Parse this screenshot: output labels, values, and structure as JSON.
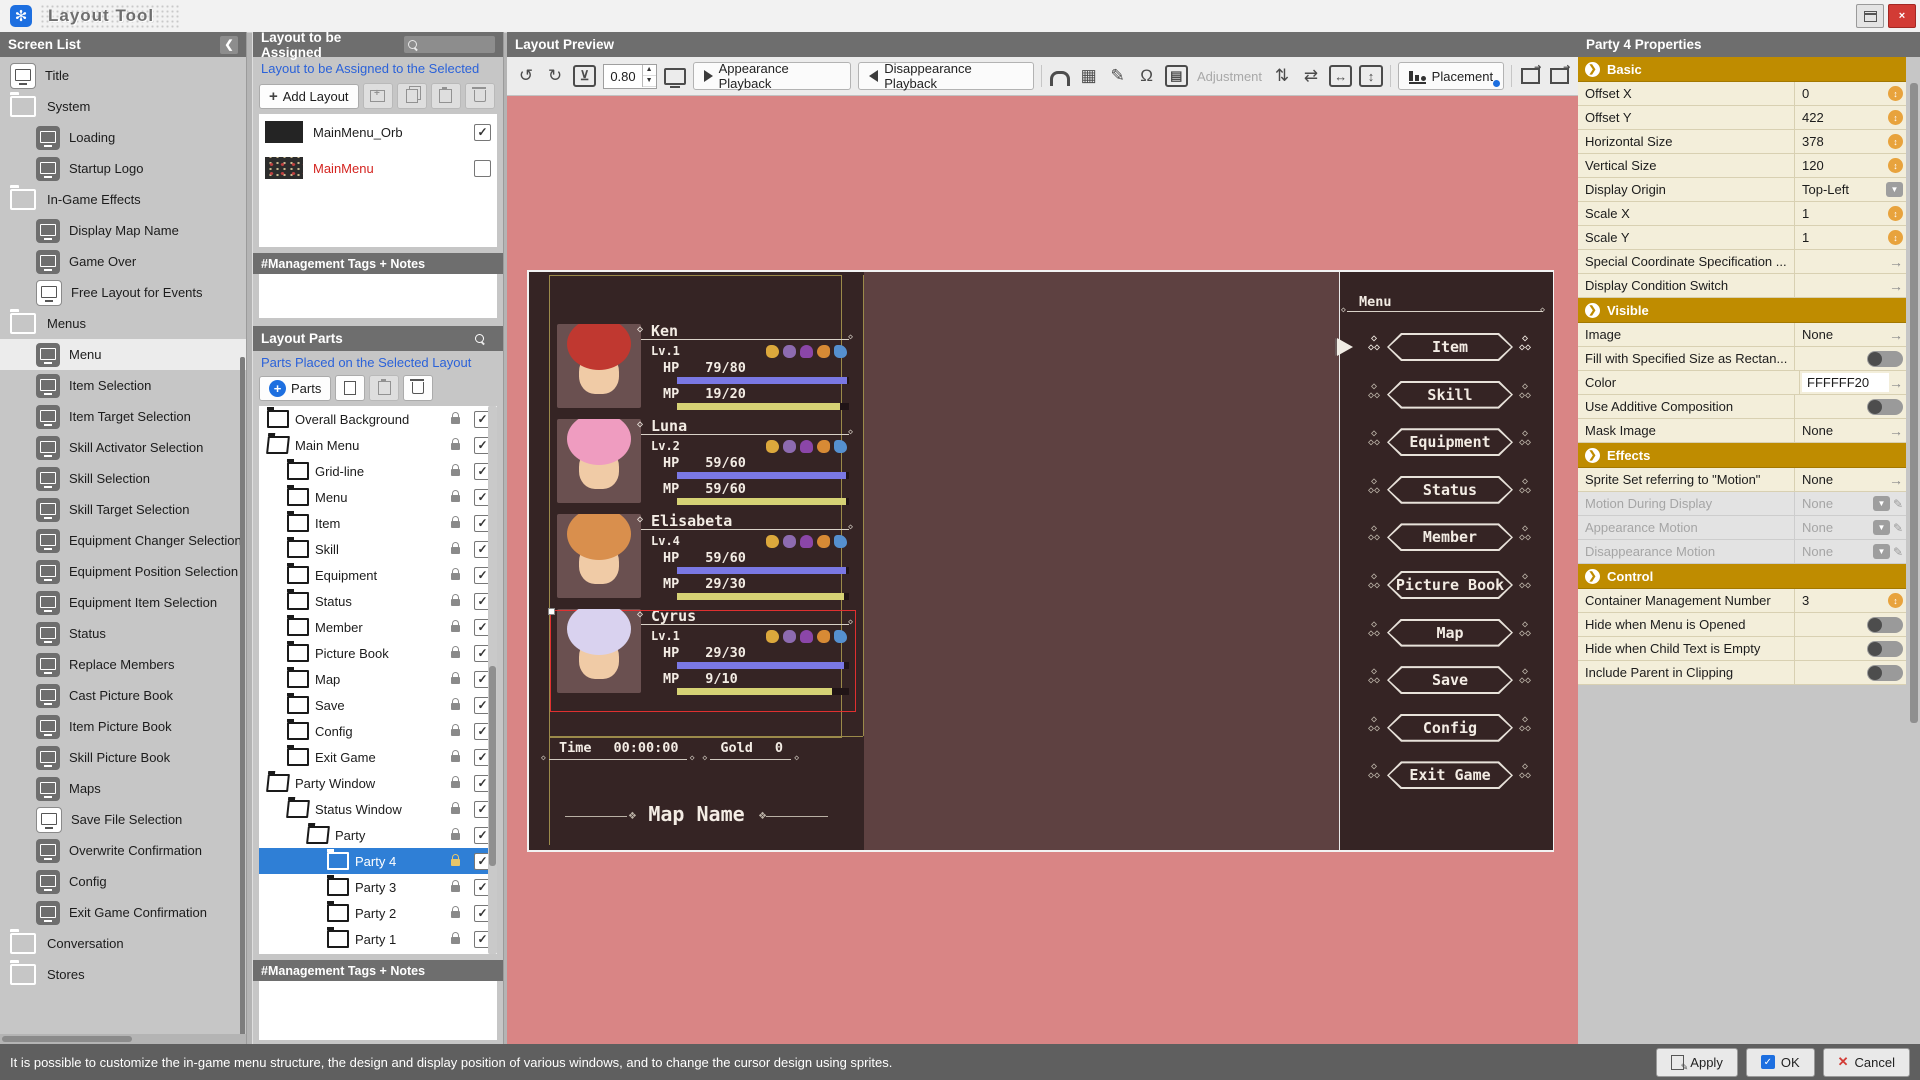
{
  "window": {
    "title": "Layout Tool",
    "close_label": "×"
  },
  "screen_list": {
    "header": "Screen List",
    "collapse_glyph": "❮",
    "items": [
      {
        "label": "Title",
        "kind": "screen",
        "indent": 0,
        "invert": true
      },
      {
        "label": "System",
        "kind": "folder",
        "indent": 0
      },
      {
        "label": "Loading",
        "kind": "screen",
        "indent": 1
      },
      {
        "label": "Startup Logo",
        "kind": "screen",
        "indent": 1
      },
      {
        "label": "In-Game Effects",
        "kind": "folder",
        "indent": 0
      },
      {
        "label": "Display Map Name",
        "kind": "screen",
        "indent": 1
      },
      {
        "label": "Game Over",
        "kind": "screen",
        "indent": 1
      },
      {
        "label": "Free Layout for Events",
        "kind": "screen",
        "indent": 1,
        "invert": true
      },
      {
        "label": "Menus",
        "kind": "folder",
        "indent": 0
      },
      {
        "label": "Menu",
        "kind": "screen",
        "indent": 1,
        "selected": true
      },
      {
        "label": "Item Selection",
        "kind": "screen",
        "indent": 1
      },
      {
        "label": "Item Target Selection",
        "kind": "screen",
        "indent": 1
      },
      {
        "label": "Skill Activator Selection",
        "kind": "screen",
        "indent": 1
      },
      {
        "label": "Skill Selection",
        "kind": "screen",
        "indent": 1
      },
      {
        "label": "Skill Target Selection",
        "kind": "screen",
        "indent": 1
      },
      {
        "label": "Equipment Changer Selection",
        "kind": "screen",
        "indent": 1
      },
      {
        "label": "Equipment Position Selection",
        "kind": "screen",
        "indent": 1
      },
      {
        "label": "Equipment Item Selection",
        "kind": "screen",
        "indent": 1
      },
      {
        "label": "Status",
        "kind": "screen",
        "indent": 1
      },
      {
        "label": "Replace Members",
        "kind": "screen",
        "indent": 1
      },
      {
        "label": "Cast Picture Book",
        "kind": "screen",
        "indent": 1
      },
      {
        "label": "Item Picture Book",
        "kind": "screen",
        "indent": 1
      },
      {
        "label": "Skill Picture Book",
        "kind": "screen",
        "indent": 1
      },
      {
        "label": "Maps",
        "kind": "screen",
        "indent": 1
      },
      {
        "label": "Save File Selection",
        "kind": "screen",
        "indent": 1,
        "invert": true
      },
      {
        "label": "Overwrite Confirmation",
        "kind": "screen",
        "indent": 1
      },
      {
        "label": "Config",
        "kind": "screen",
        "indent": 1
      },
      {
        "label": "Exit Game Confirmation",
        "kind": "screen",
        "indent": 1
      },
      {
        "label": "Conversation",
        "kind": "folder",
        "indent": 0
      },
      {
        "label": "Stores",
        "kind": "folder",
        "indent": 0
      }
    ]
  },
  "assign_panel": {
    "header": "Layout to be Assigned",
    "link": "Layout to be Assigned to the Selected",
    "add_button": "Add Layout",
    "layouts": [
      {
        "name": "MainMenu_Orb",
        "checked": true,
        "red": false,
        "dots": false
      },
      {
        "name": "MainMenu",
        "checked": false,
        "red": true,
        "dots": true
      }
    ],
    "tags_header": "#Management Tags + Notes"
  },
  "parts_panel": {
    "header": "Layout Parts",
    "link": "Parts Placed on the Selected Layout",
    "add_button": "Parts",
    "tree": [
      {
        "label": "Overall Background",
        "indent": 0,
        "icon": "t-o",
        "checked": true
      },
      {
        "label": "Main Menu",
        "indent": 0,
        "icon": "t-open",
        "checked": true
      },
      {
        "label": "Grid-line",
        "indent": 1,
        "icon": "t-o",
        "checked": true
      },
      {
        "label": "Menu",
        "indent": 1,
        "icon": "t-o",
        "checked": true
      },
      {
        "label": "Item",
        "indent": 1,
        "icon": "t-a",
        "checked": true
      },
      {
        "label": "Skill",
        "indent": 1,
        "icon": "t-a",
        "checked": true
      },
      {
        "label": "Equipment",
        "indent": 1,
        "icon": "t-a",
        "checked": true
      },
      {
        "label": "Status",
        "indent": 1,
        "icon": "t-a",
        "checked": true
      },
      {
        "label": "Member",
        "indent": 1,
        "icon": "t-a",
        "checked": true
      },
      {
        "label": "Picture Book",
        "indent": 1,
        "icon": "t-a",
        "checked": true
      },
      {
        "label": "Map",
        "indent": 1,
        "icon": "t-a",
        "checked": true
      },
      {
        "label": "Save",
        "indent": 1,
        "icon": "t-a",
        "checked": true
      },
      {
        "label": "Config",
        "indent": 1,
        "icon": "t-a",
        "checked": true
      },
      {
        "label": "Exit Game",
        "indent": 1,
        "icon": "t-a",
        "checked": true
      },
      {
        "label": "Party Window",
        "indent": 0,
        "icon": "t-open",
        "checked": true
      },
      {
        "label": "Status Window",
        "indent": 1,
        "icon": "t-open",
        "checked": true
      },
      {
        "label": "Party",
        "indent": 2,
        "icon": "t-open",
        "checked": true
      },
      {
        "label": "Party 4",
        "indent": 3,
        "icon": "t-a",
        "checked": true,
        "selected": true
      },
      {
        "label": "Party 3",
        "indent": 3,
        "icon": "t-a",
        "checked": true
      },
      {
        "label": "Party 2",
        "indent": 3,
        "icon": "t-a",
        "checked": true
      },
      {
        "label": "Party 1",
        "indent": 3,
        "icon": "t-a",
        "checked": true
      }
    ],
    "tags_header": "#Management Tags + Notes"
  },
  "preview": {
    "header": "Layout Preview",
    "zoom_value": "0.80",
    "appearance_label": "Appearance Playback",
    "disappearance_label": "Disappearance Playback",
    "adjustment_label": "Adjustment",
    "placement_label": "Placement",
    "icons": {
      "undo": "↺",
      "redo": "↻",
      "import_box": "⊻",
      "updown": "⇅",
      "swap": "⇄",
      "h_arrow": "↔",
      "v_arrow": "↕",
      "grid": "▦",
      "pen": "✎",
      "stamp": "Ω",
      "layout_box": "▤"
    }
  },
  "game": {
    "members": [
      {
        "name": "Ken",
        "level": "Lv.1",
        "hp_label": "HP",
        "hp": "79/80",
        "hp_pct": 99,
        "mp_label": "MP",
        "mp": "19/20",
        "mp_pct": 95,
        "pclass": "pt-ken"
      },
      {
        "name": "Luna",
        "level": "Lv.2",
        "hp_label": "HP",
        "hp": "59/60",
        "hp_pct": 98,
        "mp_label": "MP",
        "mp": "59/60",
        "mp_pct": 98,
        "pclass": "pt-luna"
      },
      {
        "name": "Elisabeta",
        "level": "Lv.4",
        "hp_label": "HP",
        "hp": "59/60",
        "hp_pct": 98,
        "mp_label": "MP",
        "mp": "29/30",
        "mp_pct": 97,
        "pclass": "pt-elisabeta"
      },
      {
        "name": "Cyrus",
        "level": "Lv.1",
        "hp_label": "HP",
        "hp": "29/30",
        "hp_pct": 97,
        "mp_label": "MP",
        "mp": "9/10",
        "mp_pct": 90,
        "pclass": "pt-cyrus"
      }
    ],
    "hud": {
      "time_label": "Time",
      "time_value": "00:00:00",
      "gold_label": "Gold",
      "gold_value": "0",
      "map_name": "Map Name"
    },
    "menu": {
      "header": "Menu",
      "items": [
        {
          "label": "Item",
          "selected": true
        },
        {
          "label": "Skill"
        },
        {
          "label": "Equipment"
        },
        {
          "label": "Status"
        },
        {
          "label": "Member"
        },
        {
          "label": "Picture Book"
        },
        {
          "label": "Map"
        },
        {
          "label": "Save"
        },
        {
          "label": "Config"
        },
        {
          "label": "Exit Game"
        }
      ]
    }
  },
  "properties": {
    "header": "Party 4 Properties",
    "sections": [
      {
        "title": "Basic",
        "rows": [
          {
            "label": "Offset X",
            "value": "0",
            "control": "c-spinner"
          },
          {
            "label": "Offset Y",
            "value": "422",
            "control": "c-spinner"
          },
          {
            "label": "Horizontal Size",
            "value": "378",
            "control": "c-spinner"
          },
          {
            "label": "Vertical Size",
            "value": "120",
            "control": "c-spinner"
          },
          {
            "label": "Display Origin",
            "value": "Top-Left",
            "control": "c-dropdown"
          },
          {
            "label": "Scale X",
            "value": "1",
            "control": "c-spinner"
          },
          {
            "label": "Scale Y",
            "value": "1",
            "control": "c-spinner"
          },
          {
            "label": "Special Coordinate Specification ...",
            "value": "",
            "control": "c-arrow"
          },
          {
            "label": "Display Condition Switch",
            "value": "",
            "control": "c-arrow"
          }
        ]
      },
      {
        "title": "Visible",
        "rows": [
          {
            "label": "Image",
            "value": "None",
            "control": "c-arrow"
          },
          {
            "label": "Fill with Specified Size as Rectan...",
            "value": "",
            "control": "c-toggle"
          },
          {
            "label": "Color",
            "value": "FFFFFF20",
            "control": "c-input-arrow"
          },
          {
            "label": "Use Additive Composition",
            "value": "",
            "control": "c-toggle"
          },
          {
            "label": "Mask Image",
            "value": "None",
            "control": "c-arrow"
          }
        ]
      },
      {
        "title": "Effects",
        "rows": [
          {
            "label": "Sprite Set referring to \"Motion\"",
            "value": "None",
            "control": "c-arrow"
          },
          {
            "label": "Motion During Display",
            "value": "None",
            "control": "c-dropdown-pencil",
            "disabled": true
          },
          {
            "label": "Appearance Motion",
            "value": "None",
            "control": "c-dropdown-pencil",
            "disabled": true
          },
          {
            "label": "Disappearance Motion",
            "value": "None",
            "control": "c-dropdown-pencil",
            "disabled": true
          }
        ]
      },
      {
        "title": "Control",
        "rows": [
          {
            "label": "Container Management Number",
            "value": "3",
            "control": "c-spinner"
          },
          {
            "label": "Hide when Menu is Opened",
            "value": "",
            "control": "c-toggle"
          },
          {
            "label": "Hide when Child Text is Empty",
            "value": "",
            "control": "c-toggle"
          },
          {
            "label": "Include Parent in Clipping",
            "value": "",
            "control": "c-toggle"
          }
        ]
      }
    ]
  },
  "status_bar": {
    "message": "It is possible to customize the in-game menu structure, the design and display position of various windows, and to change the cursor design using sprites.",
    "apply_label": "Apply",
    "ok_label": "OK",
    "cancel_label": "Cancel"
  }
}
